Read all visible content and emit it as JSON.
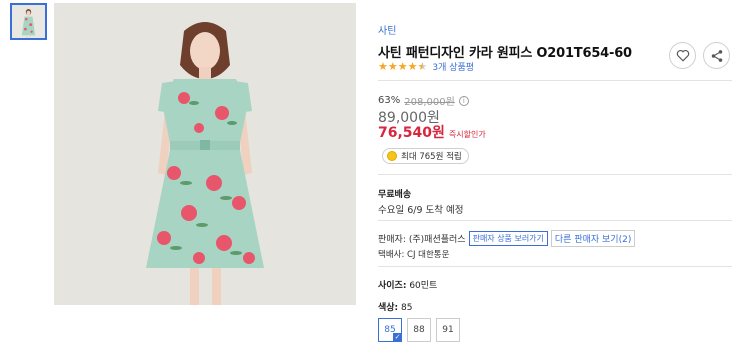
{
  "brand": "사틴",
  "product_title": "사틴 패턴디자인 카라 원피스 O201T654-60",
  "rating": {
    "stars": 4.5,
    "review_link": "3개 상품평"
  },
  "price": {
    "discount_rate": "63%",
    "original": "208,000원",
    "sale": "89,000원",
    "final": "76,540원",
    "final_note": "즉시할인가"
  },
  "points": "최대 765원 적립",
  "shipping": {
    "label": "무료배송",
    "date": "수요일 6/9 도착 예정"
  },
  "seller": {
    "label": "판매자:",
    "name": "(주)패션플러스",
    "view_products": "판매자 상품 보러가기",
    "other_sellers": "다른 판매자 보기(2)"
  },
  "courier": "택배사: CJ 대한통운",
  "size": {
    "label": "사이즈:",
    "value": "60민트"
  },
  "color": {
    "label": "색상:",
    "value": "85"
  },
  "options": [
    "85",
    "88",
    "91"
  ],
  "selected_option": "85",
  "colors": {
    "accent": "#3b6fd8",
    "price_red": "#d7263d",
    "star": "#f5a623",
    "dress_base": "#a8d4c4",
    "flower": "#e8566b"
  },
  "icons": [
    "heart-icon",
    "share-icon",
    "info-icon",
    "coin-icon",
    "check-icon"
  ]
}
